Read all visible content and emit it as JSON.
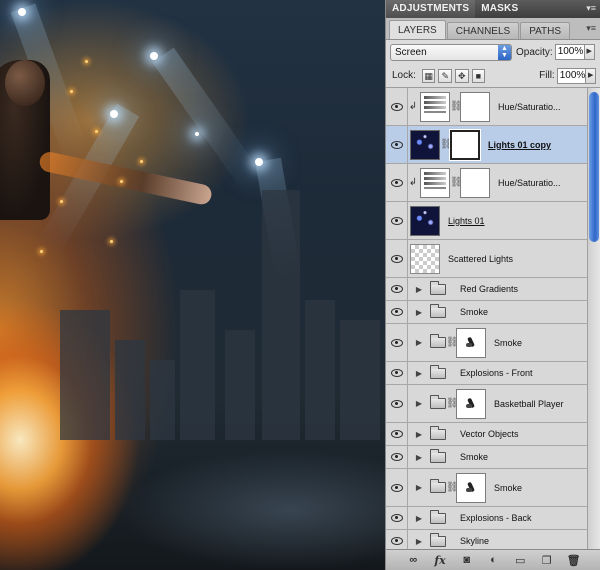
{
  "panel": {
    "top_tabs": [
      "ADJUSTMENTS",
      "MASKS"
    ],
    "sub_tabs": [
      "LAYERS",
      "CHANNELS",
      "PATHS"
    ],
    "blend_mode": "Screen",
    "opacity_label": "Opacity:",
    "opacity_value": "100%",
    "lock_label": "Lock:",
    "fill_label": "Fill:",
    "fill_value": "100%"
  },
  "layers": [
    {
      "name": "Hue/Saturatio...",
      "kind": "adjustment",
      "clipped": true
    },
    {
      "name": "Lights 01 copy",
      "kind": "image-mask",
      "selected": true
    },
    {
      "name": "Hue/Saturatio...",
      "kind": "adjustment",
      "clipped": true
    },
    {
      "name": "Lights 01",
      "kind": "image"
    },
    {
      "name": "Scattered Lights",
      "kind": "transparent"
    },
    {
      "name": "Red Gradients",
      "kind": "group"
    },
    {
      "name": "Smoke",
      "kind": "group"
    },
    {
      "name": "Smoke",
      "kind": "group-mask"
    },
    {
      "name": "Explosions - Front",
      "kind": "group"
    },
    {
      "name": "Basketball Player",
      "kind": "group-mask"
    },
    {
      "name": "Vector Objects",
      "kind": "group"
    },
    {
      "name": "Smoke",
      "kind": "group"
    },
    {
      "name": "Smoke",
      "kind": "group-mask"
    },
    {
      "name": "Explosions - Back",
      "kind": "group"
    },
    {
      "name": "Skyline",
      "kind": "group"
    }
  ],
  "icons": {
    "visibility": "eye-icon",
    "group": "folder-icon",
    "expand": "triangle-right-icon",
    "link": "chain-icon"
  },
  "bottom_icons": [
    "link-icon",
    "fx-icon",
    "mask-icon",
    "adjustment-icon",
    "group-icon",
    "new-layer-icon",
    "trash-icon"
  ],
  "colors": {
    "selected_row": "#b9cde9",
    "panel_bg": "#d8d8d8",
    "accent_blue": "#2f67c8"
  }
}
